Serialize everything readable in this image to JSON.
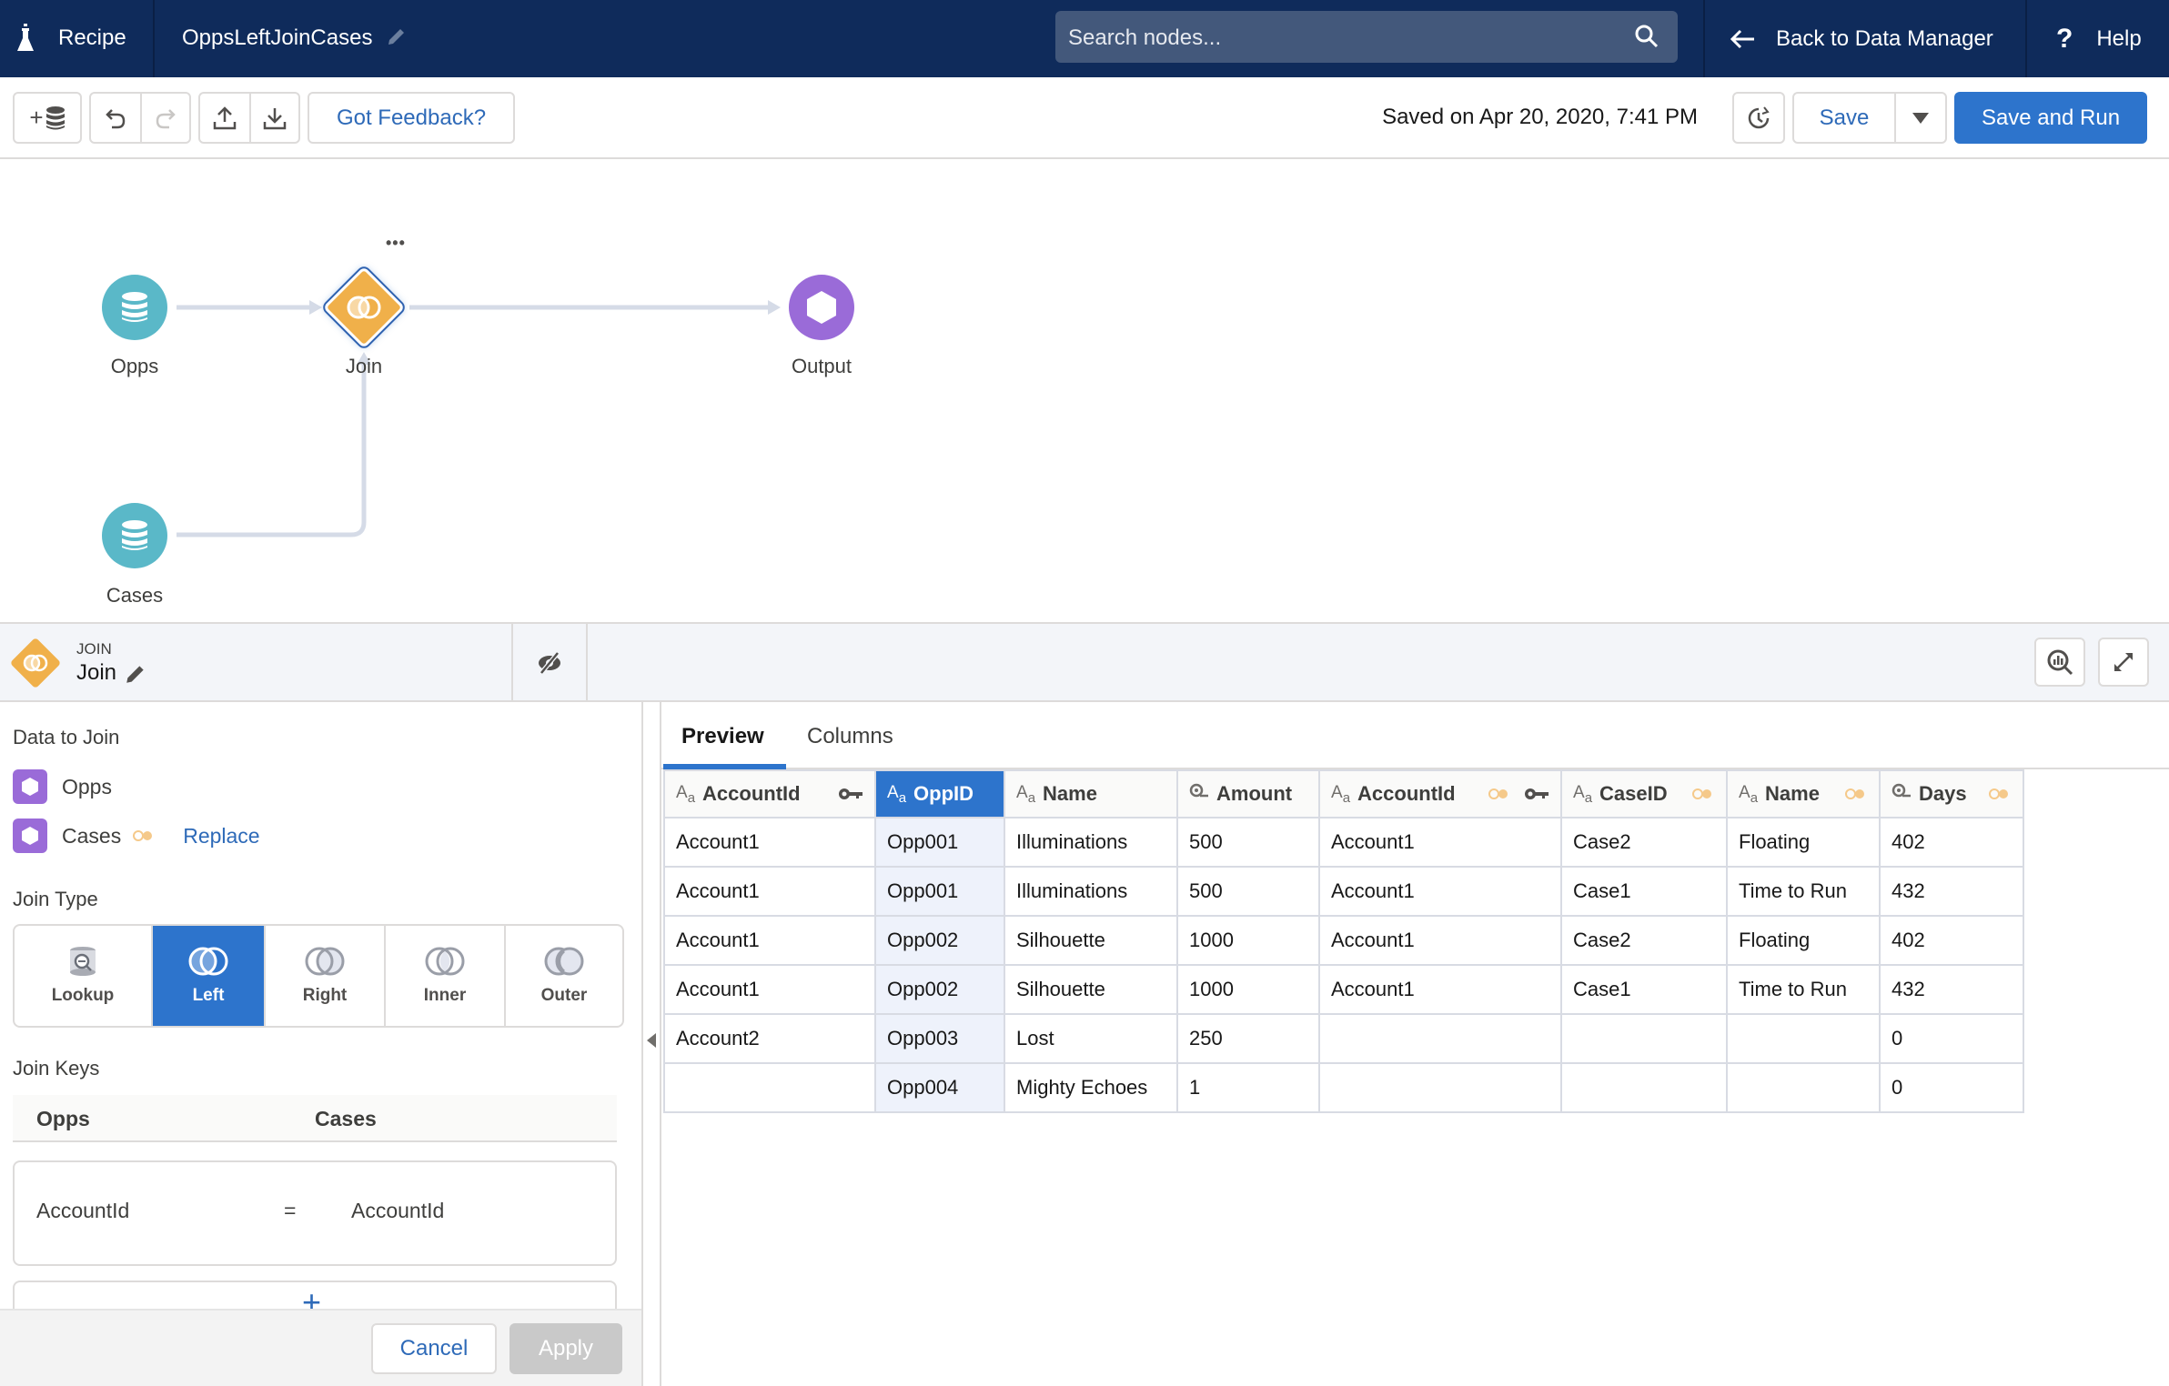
{
  "header": {
    "app_label": "Recipe",
    "recipe_name": "OppsLeftJoinCases",
    "search_placeholder": "Search nodes...",
    "back_label": "Back to Data Manager",
    "help_label": "Help"
  },
  "toolbar": {
    "feedback_label": "Got Feedback?",
    "saved_text": "Saved on Apr 20, 2020, 7:41 PM",
    "save_label": "Save",
    "save_and_run_label": "Save and Run"
  },
  "canvas": {
    "nodes": [
      {
        "label": "Opps",
        "type": "input"
      },
      {
        "label": "Join",
        "type": "join",
        "selected": true
      },
      {
        "label": "Output",
        "type": "output"
      },
      {
        "label": "Cases",
        "type": "input"
      }
    ],
    "more_label": "•••"
  },
  "node_panel": {
    "type_label": "JOIN",
    "name": "Join"
  },
  "config": {
    "data_to_join_label": "Data to Join",
    "sources": [
      {
        "name": "Opps"
      },
      {
        "name": "Cases",
        "action": "Replace"
      }
    ],
    "join_type_label": "Join Type",
    "join_types": [
      {
        "label": "Lookup",
        "active": false
      },
      {
        "label": "Left",
        "active": true
      },
      {
        "label": "Right",
        "active": false
      },
      {
        "label": "Inner",
        "active": false
      },
      {
        "label": "Outer",
        "active": false
      }
    ],
    "join_keys_label": "Join Keys",
    "keys_left_header": "Opps",
    "keys_right_header": "Cases",
    "keys": [
      {
        "left": "AccountId",
        "op": "=",
        "right": "AccountId"
      }
    ],
    "add_key_label": "+",
    "cancel_label": "Cancel",
    "apply_label": "Apply"
  },
  "preview": {
    "tabs": [
      {
        "label": "Preview",
        "active": true
      },
      {
        "label": "Columns",
        "active": false
      }
    ],
    "columns": [
      {
        "name": "AccountId",
        "type": "text",
        "key": true,
        "from_right": false
      },
      {
        "name": "OppID",
        "type": "text",
        "selected": true,
        "from_right": false
      },
      {
        "name": "Name",
        "type": "text",
        "from_right": false
      },
      {
        "name": "Amount",
        "type": "number",
        "from_right": false
      },
      {
        "name": "AccountId",
        "type": "text",
        "key": true,
        "from_right": true
      },
      {
        "name": "CaseID",
        "type": "text",
        "from_right": true
      },
      {
        "name": "Name",
        "type": "text",
        "from_right": true
      },
      {
        "name": "Days",
        "type": "number",
        "from_right": true
      }
    ],
    "rows": [
      [
        "Account1",
        "Opp001",
        "Illuminations",
        "500",
        "Account1",
        "Case2",
        "Floating",
        "402"
      ],
      [
        "Account1",
        "Opp001",
        "Illuminations",
        "500",
        "Account1",
        "Case1",
        "Time to Run",
        "432"
      ],
      [
        "Account1",
        "Opp002",
        "Silhouette",
        "1000",
        "Account1",
        "Case2",
        "Floating",
        "402"
      ],
      [
        "Account1",
        "Opp002",
        "Silhouette",
        "1000",
        "Account1",
        "Case1",
        "Time to Run",
        "432"
      ],
      [
        "Account2",
        "Opp003",
        "Lost",
        "250",
        "",
        "",
        "",
        "0"
      ],
      [
        "",
        "Opp004",
        "Mighty Echoes",
        "1",
        "",
        "",
        "",
        "0"
      ]
    ]
  },
  "colors": {
    "header_bg": "#0f2b5b",
    "brand_blue": "#2d74cc",
    "join_orange": "#f0b04a",
    "input_teal": "#5ab8c8",
    "output_purple": "#9a6bd8"
  }
}
